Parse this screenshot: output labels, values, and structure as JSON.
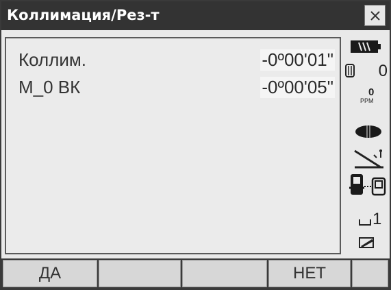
{
  "window": {
    "title": "Коллимация/Рез-т"
  },
  "rows": [
    {
      "label": "Коллим.",
      "value": "-0º00'01\""
    },
    {
      "label": "М_0 ВК",
      "value": "-0º00'05\""
    }
  ],
  "status": {
    "battery_icon": "battery-icon",
    "prism_constant": "0",
    "ppm_value": "0",
    "ppm_unit": "PPM",
    "target_icon": "target-sheet-icon",
    "tilt_icon": "tilt-compensation-icon",
    "comm_icon": "communication-icon",
    "level_label": "1",
    "input_mode_icon": "input-mode-icon"
  },
  "softkeys": [
    "ДА",
    "",
    "",
    "НЕТ",
    ""
  ]
}
